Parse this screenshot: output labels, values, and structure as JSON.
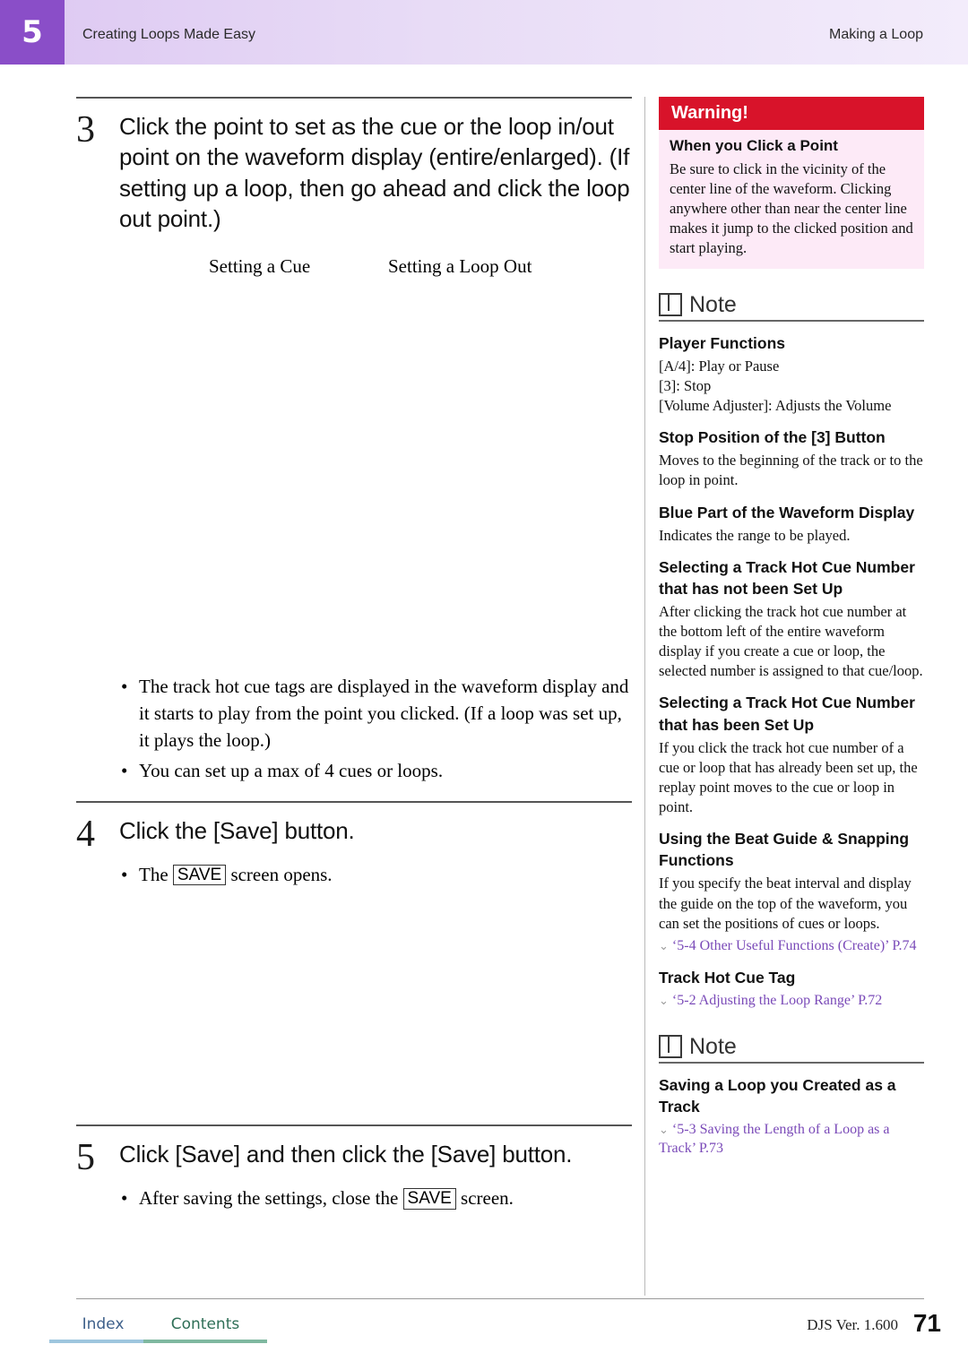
{
  "header": {
    "chapter_number": "5",
    "chapter_title": "Creating Loops Made Easy",
    "section_title": "Making a Loop"
  },
  "left": {
    "step3": {
      "number": "3",
      "text": "Click the point to set as the cue or the loop in/out point on the waveform display (entire/enlarged). (If setting up a loop, then go ahead and click the loop out point.)",
      "caption_left": "Setting a Cue",
      "caption_right": "Setting a Loop Out",
      "bullet1_a": "The track hot cue tags are displayed in the waveform display and it starts to play from the point you clicked. (If a loop was set up, it plays the loop.)",
      "bullet2": "You can set up a max of 4 cues or loops."
    },
    "step4": {
      "number": "4",
      "text": "Click the [Save] button.",
      "bullet_pre": "The ",
      "bullet_boxed": "SAVE",
      "bullet_post": " screen opens."
    },
    "step5": {
      "number": "5",
      "text": "Click [Save] and then click the [Save] button.",
      "bullet_pre": "After saving the settings, close the ",
      "bullet_boxed": "SAVE",
      "bullet_post": " screen."
    }
  },
  "right": {
    "warning": {
      "header": "Warning!",
      "title": "When you Click a Point",
      "body": "Be sure to click in the vicinity of the center line of the waveform. Clicking anywhere other than near the center line makes it jump to the clicked position and start playing."
    },
    "note1": {
      "label": "Note",
      "sections": [
        {
          "title": "Player Functions",
          "lines": [
            "[A/4]: Play or Pause",
            "[3]: Stop",
            "[Volume Adjuster]: Adjusts the Volume"
          ]
        },
        {
          "title": "Stop Position of the [3] Button",
          "body": "Moves to the beginning of the track or to the loop in point."
        },
        {
          "title": "Blue Part of the Waveform Display",
          "body": "Indicates the range to be played."
        },
        {
          "title": "Selecting a Track Hot Cue Number that has not been Set Up",
          "body": "After clicking the track hot cue number at the bottom left of the entire waveform display if you create a cue or loop, the selected number is assigned to that cue/loop."
        },
        {
          "title": "Selecting a Track Hot Cue Number that has been Set Up",
          "body": "If you click the track hot cue number of a cue or loop that has already been set up, the replay point moves to the cue or loop in point."
        },
        {
          "title": "Using the Beat Guide & Snapping Functions",
          "body": "If you specify the beat interval and display the guide on the top of the waveform, you can set the positions of cues or loops.",
          "xref": "‘5-4 Other Useful Functions (Create)’ P.74"
        },
        {
          "title": "Track Hot Cue Tag",
          "xref": "‘5-2 Adjusting the Loop Range’ P.72"
        }
      ]
    },
    "note2": {
      "label": "Note",
      "sections": [
        {
          "title": "Saving a Loop you Created as a Track",
          "xref": "‘5-3 Saving the Length of a Loop as a Track’ P.73"
        }
      ]
    }
  },
  "footer": {
    "index": "Index",
    "contents": "Contents",
    "version": "DJS Ver.  1.600",
    "page": "71"
  }
}
